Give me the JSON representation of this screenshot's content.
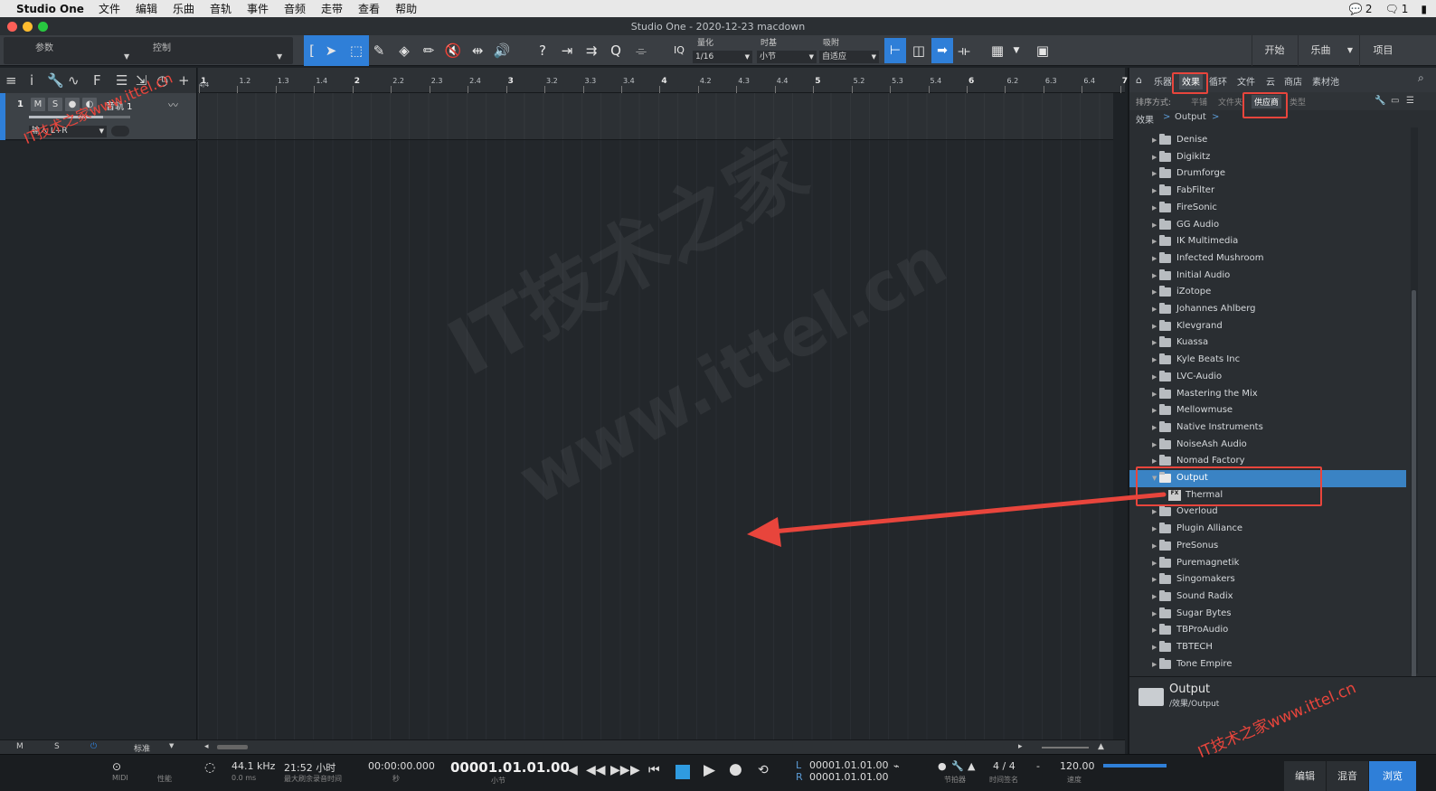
{
  "mac_menubar": {
    "app_name": "Studio One",
    "menus": [
      "文件",
      "编辑",
      "乐曲",
      "音轨",
      "事件",
      "音频",
      "走带",
      "查看",
      "帮助"
    ],
    "wechat_count": "2",
    "notify_count": "1"
  },
  "window": {
    "title": "Studio One - 2020-12-23 macdown"
  },
  "toolbar": {
    "param_label": "参数",
    "control_label": "控制",
    "iq_label": "IQ",
    "quantize_label": "量化",
    "quantize_value": "1/16",
    "timebase_label": "时基",
    "timebase_value": "小节",
    "snap_label": "吸附",
    "snap_value": "自适应",
    "start_label": "开始",
    "song_label": "乐曲",
    "project_label": "项目"
  },
  "ruler": {
    "timesig": "4/4",
    "marks": [
      "1",
      "1.2",
      "1.3",
      "1.4",
      "2",
      "2.2",
      "2.3",
      "2.4",
      "3",
      "3.2",
      "3.3",
      "3.4",
      "4",
      "4.2",
      "4.3",
      "4.4",
      "5",
      "5.2",
      "5.3",
      "5.4",
      "6",
      "6.2",
      "6.3",
      "6.4",
      "7"
    ]
  },
  "track": {
    "number": "1",
    "mute": "M",
    "solo": "S",
    "name": "音轨 1",
    "input": "输入 L+R"
  },
  "edit_footer": {
    "m": "M",
    "s": "S",
    "mode": "标准"
  },
  "browser": {
    "tabs": [
      "乐器",
      "效果",
      "循环",
      "文件",
      "云",
      "商店",
      "素材池"
    ],
    "active_tab": "效果",
    "sort_label": "排序方式:",
    "sort_options": [
      "平铺",
      "文件夹",
      "供应商",
      "类型"
    ],
    "active_sort": "供应商",
    "breadcrumb": [
      "效果",
      ">",
      "Output",
      ">"
    ],
    "items": [
      {
        "name": "Denise",
        "type": "folder"
      },
      {
        "name": "Digikitz",
        "type": "folder"
      },
      {
        "name": "Drumforge",
        "type": "folder"
      },
      {
        "name": "FabFilter",
        "type": "folder"
      },
      {
        "name": "FireSonic",
        "type": "folder"
      },
      {
        "name": "GG Audio",
        "type": "folder"
      },
      {
        "name": "IK Multimedia",
        "type": "folder"
      },
      {
        "name": "Infected Mushroom",
        "type": "folder"
      },
      {
        "name": "Initial Audio",
        "type": "folder"
      },
      {
        "name": "iZotope",
        "type": "folder"
      },
      {
        "name": "Johannes Ahlberg",
        "type": "folder"
      },
      {
        "name": "Klevgrand",
        "type": "folder"
      },
      {
        "name": "Kuassa",
        "type": "folder"
      },
      {
        "name": "Kyle Beats Inc",
        "type": "folder"
      },
      {
        "name": "LVC-Audio",
        "type": "folder"
      },
      {
        "name": "Mastering the Mix",
        "type": "folder"
      },
      {
        "name": "Mellowmuse",
        "type": "folder"
      },
      {
        "name": "Native Instruments",
        "type": "folder"
      },
      {
        "name": "NoiseAsh Audio",
        "type": "folder"
      },
      {
        "name": "Nomad Factory",
        "type": "folder"
      },
      {
        "name": "Output",
        "type": "folder-open",
        "selected": true
      },
      {
        "name": "Thermal",
        "type": "plugin"
      },
      {
        "name": "Overloud",
        "type": "folder"
      },
      {
        "name": "Plugin Alliance",
        "type": "folder"
      },
      {
        "name": "PreSonus",
        "type": "folder"
      },
      {
        "name": "Puremagnetik",
        "type": "folder"
      },
      {
        "name": "Singomakers",
        "type": "folder"
      },
      {
        "name": "Sound Radix",
        "type": "folder"
      },
      {
        "name": "Sugar Bytes",
        "type": "folder"
      },
      {
        "name": "TBProAudio",
        "type": "folder"
      },
      {
        "name": "TBTECH",
        "type": "folder"
      },
      {
        "name": "Tone Empire",
        "type": "folder"
      }
    ],
    "info_title": "Output",
    "info_path": "/效果/Output"
  },
  "transport": {
    "midi_label": "MIDI",
    "perf_label": "性能",
    "sample_rate": "44.1 kHz",
    "latency": "0.0 ms",
    "time_remaining": "21:52 小时",
    "max_rec_label": "最大刷余录音时间",
    "seconds": "00:00:00.000",
    "seconds_label": "秒",
    "bars": "00001.01.01.00",
    "bars_label": "小节",
    "loop_l": "00001.01.01.00",
    "loop_r": "00001.01.01.00",
    "l_label": "L",
    "r_label": "R",
    "metronome_label": "节拍器",
    "timesig": "4 / 4",
    "timesig_label": "时间签名",
    "dash": "-",
    "tempo": "120.00",
    "tempo_label": "速度",
    "edit_btn": "编辑",
    "mix_btn": "混音",
    "browse_btn": "浏览"
  },
  "watermarks": {
    "top_left": "IT技术之家www.ittel.cn",
    "bottom_right": "IT技术之家www.ittel.cn",
    "center_line1": "IT技术之家",
    "center_line2": "www.ittel.cn"
  },
  "colors": {
    "accent": "#2f7fd8",
    "highlight": "#e8453c",
    "selected_row": "#3a83c4"
  }
}
